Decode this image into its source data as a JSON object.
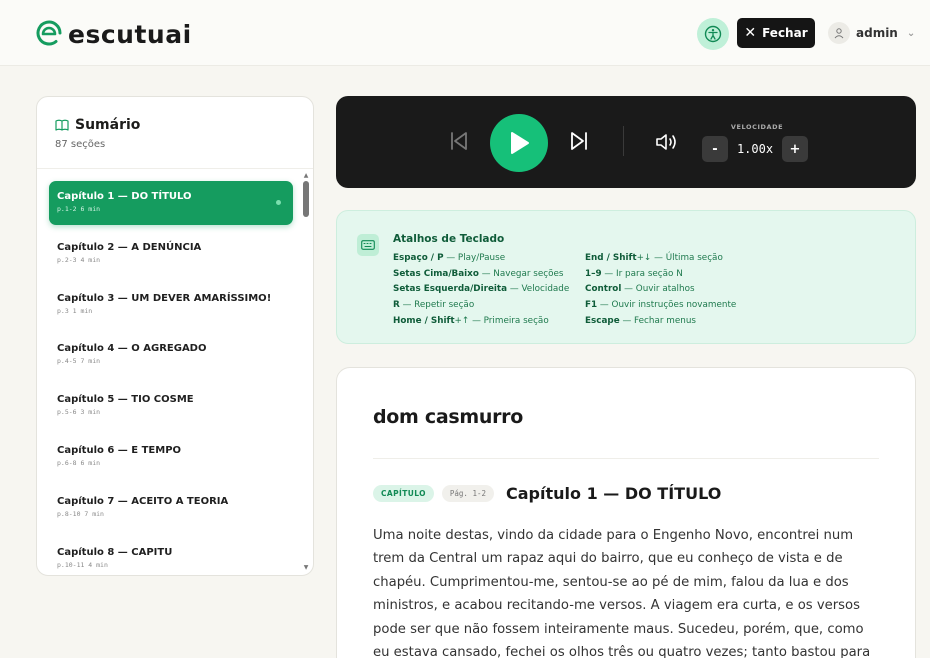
{
  "header": {
    "brand": "escutuai",
    "close_label": "Fechar",
    "user": "admin"
  },
  "colors": {
    "accent": "#159c5f",
    "play": "#16c079",
    "player_bg": "#1a1a1a",
    "shortcuts_bg": "#e4f7ee"
  },
  "sidebar": {
    "title": "Sumário",
    "count": "87 seções",
    "items": [
      {
        "title": "Capítulo 1 — DO TÍTULO",
        "meta": "p.1-2 6 min"
      },
      {
        "title": "Capítulo 2 — A DENÚNCIA",
        "meta": "p.2-3 4 min"
      },
      {
        "title": "Capítulo 3 — UM DEVER AMARÍSSIMO!",
        "meta": "p.3 1 min"
      },
      {
        "title": "Capítulo 4 — O AGREGADO",
        "meta": "p.4-5 7 min"
      },
      {
        "title": "Capítulo 5 — TIO COSME",
        "meta": "p.5-6 3 min"
      },
      {
        "title": "Capítulo 6 — E TEMPO",
        "meta": "p.6-8 6 min"
      },
      {
        "title": "Capítulo 7 — ACEITO A TEORIA",
        "meta": "p.8-10 7 min"
      },
      {
        "title": "Capítulo 8 — CAPITU",
        "meta": "p.10-11 4 min"
      }
    ]
  },
  "player": {
    "speed_label": "VELOCIDADE",
    "speed_value": "1.00x",
    "minus": "-",
    "plus": "+"
  },
  "shortcuts": {
    "title": "Atalhos de Teclado",
    "left": [
      {
        "key": "Espaço / P",
        "desc": " — Play/Pause"
      },
      {
        "key": "Setas Cima/Baixo",
        "desc": " — Navegar seções"
      },
      {
        "key": "Setas Esquerda/Direita",
        "desc": " — Velocidade"
      },
      {
        "key": "R",
        "desc": " — Repetir seção"
      },
      {
        "key": "Home / Shift",
        "desc": "+↑ — Primeira seção"
      }
    ],
    "right": [
      {
        "key": "End / Shift",
        "desc": "+↓ — Última seção"
      },
      {
        "key": "1–9",
        "desc": " — Ir para seção N"
      },
      {
        "key": "Control",
        "desc": " — Ouvir atalhos"
      },
      {
        "key": "F1",
        "desc": " — Ouvir instruções novamente"
      },
      {
        "key": "Escape",
        "desc": " — Fechar menus"
      }
    ]
  },
  "reader": {
    "book_title": "dom casmurro",
    "tag_chapter": "CAPÍTULO",
    "tag_pages": "Pág. 1-2",
    "chapter_title": "Capítulo 1 — DO TÍTULO",
    "text": "Uma noite destas, vindo da cidade para o Engenho Novo, encontrei num trem da Central um rapaz aqui do bairro, que eu conheço de vista e de chapéu. Cumprimentou-me, sentou-se ao pé de mim, falou da lua e dos ministros, e acabou recitando-me versos. A viagem era curta, e os versos pode ser que não fossem inteiramente maus. Sucedeu, porém, que, como eu estava cansado, fechei os olhos três ou quatro vezes; tanto bastou para que ele interrompesse a"
  }
}
